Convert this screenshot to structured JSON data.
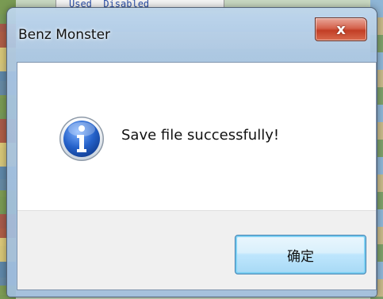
{
  "background": {
    "partial_header_text": "Used  Disabled"
  },
  "dialog": {
    "title": "Benz Monster",
    "close_glyph": "x",
    "message": "Save file successfully!",
    "icon": "information-icon",
    "ok_label": "确定"
  },
  "colors": {
    "icon_blue": "#1f5fbf",
    "close_red": "#c23e25",
    "button_border": "#3c7fb1"
  }
}
